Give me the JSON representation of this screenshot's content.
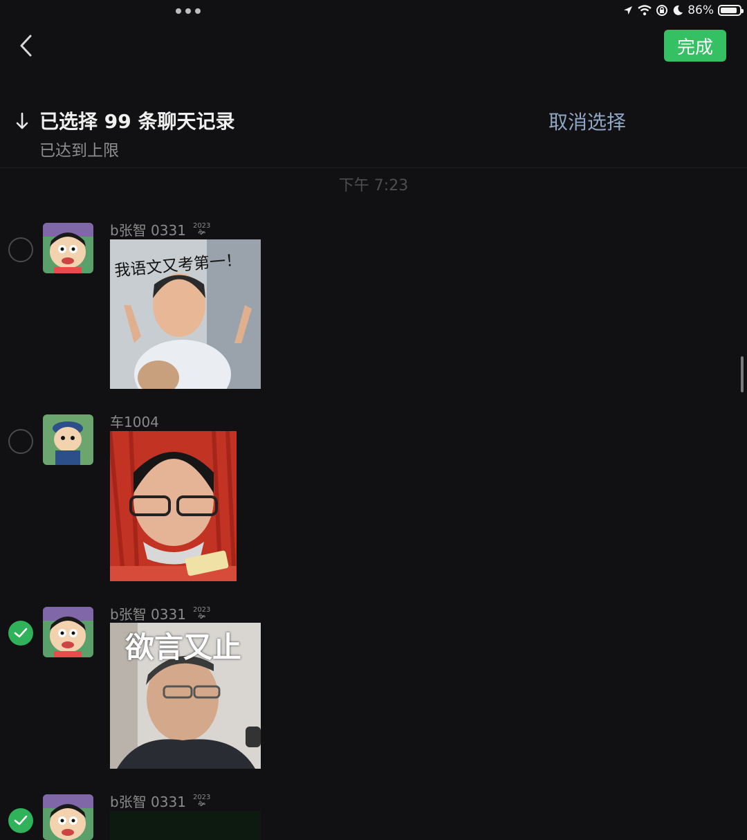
{
  "status_bar": {
    "battery": "86%",
    "battery_level": 0.86
  },
  "nav": {
    "done_label": "完成"
  },
  "selection": {
    "title": "已选择 99 条聊天记录",
    "subtitle": "已达到上限",
    "cancel_label": "取消选择"
  },
  "timestamp": "下午 7:23",
  "messages": [
    {
      "sender": "b张智 0331",
      "badge": "2023",
      "selected": false,
      "caption": "我语文又考第一！"
    },
    {
      "sender": "车1004",
      "badge": "",
      "selected": false,
      "caption": ""
    },
    {
      "sender": "b张智 0331",
      "badge": "2023",
      "selected": true,
      "caption": "欲言又止"
    },
    {
      "sender": "b张智 0331",
      "badge": "2023",
      "selected": true,
      "caption": ""
    }
  ],
  "colors": {
    "accent": "#35c063",
    "background": "#111113",
    "link": "#8fa6c4"
  }
}
